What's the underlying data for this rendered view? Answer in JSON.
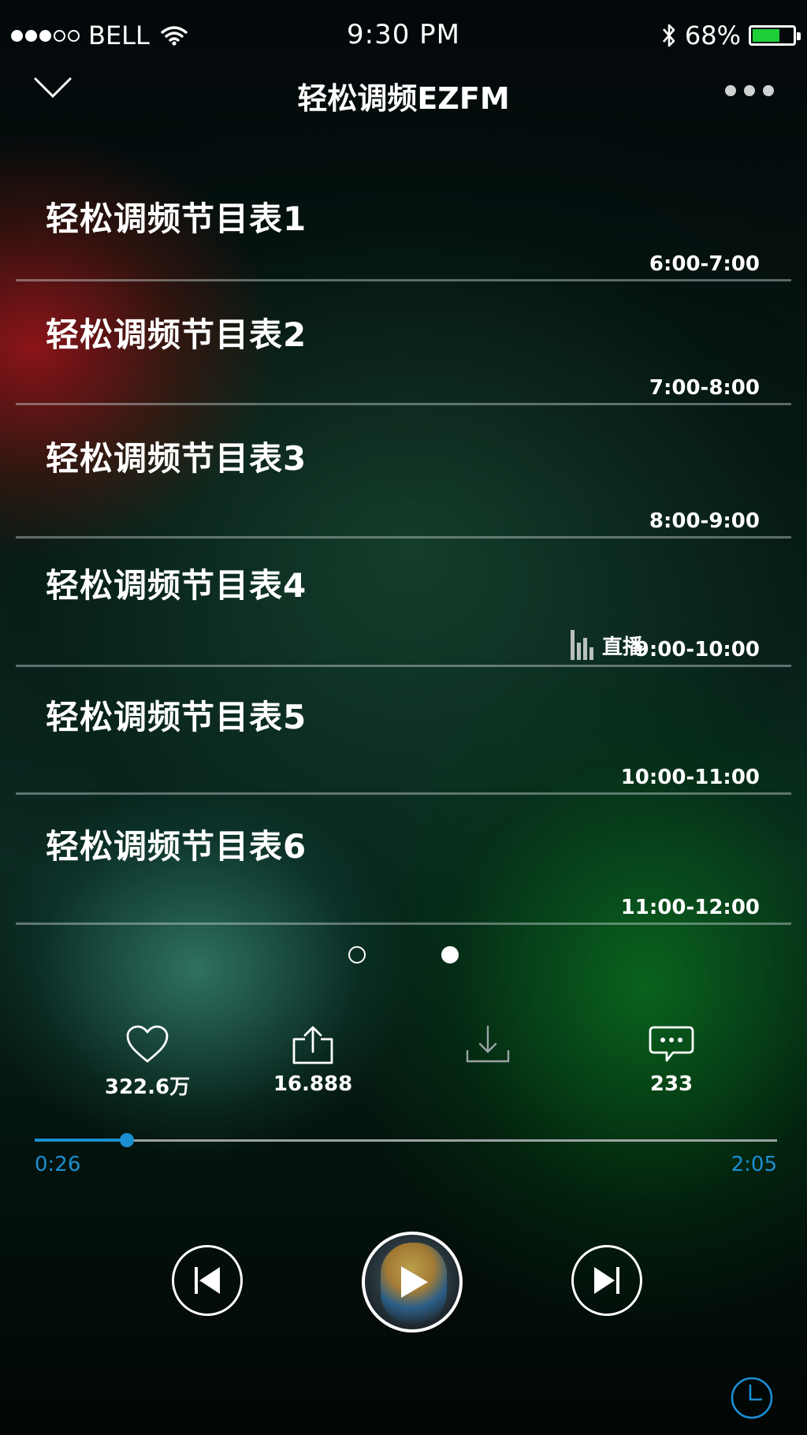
{
  "status_bar": {
    "carrier": "BELL",
    "time": "9:30 PM",
    "battery_percent": "68%",
    "battery_level": 0.68,
    "battery_color": "#1fcf3a"
  },
  "nav": {
    "back_icon": "chevron-down-icon",
    "title": "轻松调频EZFM",
    "more_icon": "more-dots-icon"
  },
  "schedule": [
    {
      "title": "轻松调频节目表1",
      "time": "6:00-7:00",
      "live": false
    },
    {
      "title": "轻松调频节目表2",
      "time": "7:00-8:00",
      "live": false
    },
    {
      "title": "轻松调频节目表3",
      "time": "8:00-9:00",
      "live": false
    },
    {
      "title": "轻松调频节目表4",
      "time": "9:00-10:00",
      "live": true,
      "live_label": "直播"
    },
    {
      "title": "轻松调频节目表5",
      "time": "10:00-11:00",
      "live": false
    },
    {
      "title": "轻松调频节目表6",
      "time": "11:00-12:00",
      "live": false
    }
  ],
  "pager": {
    "pages": 2,
    "current": 2
  },
  "actions": [
    {
      "name": "like",
      "icon": "heart-icon",
      "label": "322.6万"
    },
    {
      "name": "share",
      "icon": "share-icon",
      "label": "16.888"
    },
    {
      "name": "download",
      "icon": "download-icon",
      "label": ""
    },
    {
      "name": "comment",
      "icon": "comment-icon",
      "label": "233"
    }
  ],
  "player": {
    "elapsed": "0:26",
    "total": "2:05",
    "progress": 0.124,
    "accent_color": "#1b8fd2"
  },
  "controls": {
    "prev_icon": "skip-previous-icon",
    "play_icon": "play-icon",
    "next_icon": "skip-next-icon",
    "timer_icon": "clock-icon"
  }
}
